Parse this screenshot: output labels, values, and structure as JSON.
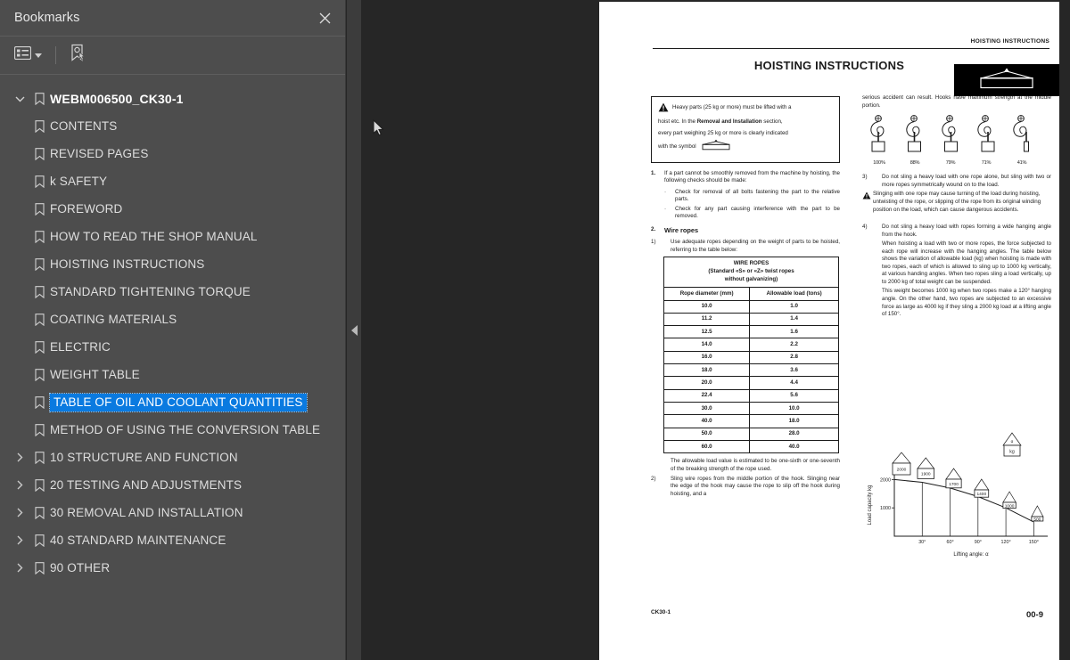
{
  "sidebar": {
    "title": "Bookmarks",
    "close_icon": "close-icon",
    "toolbar": {
      "options_icon": "list-options-icon",
      "caret_icon": "chevron-down-icon",
      "new_bookmark_icon": "new-bookmark-icon"
    },
    "root": {
      "label": "WEBM006500_CK30-1",
      "expanded": true
    },
    "items": [
      {
        "label": "CONTENTS",
        "expandable": false,
        "selected": false
      },
      {
        "label": "REVISED PAGES",
        "expandable": false,
        "selected": false
      },
      {
        "label": "k SAFETY",
        "expandable": false,
        "selected": false
      },
      {
        "label": "FOREWORD",
        "expandable": false,
        "selected": false
      },
      {
        "label": "HOW TO READ THE SHOP MANUAL",
        "expandable": false,
        "selected": false
      },
      {
        "label": "HOISTING INSTRUCTIONS",
        "expandable": false,
        "selected": false
      },
      {
        "label": "STANDARD TIGHTENING TORQUE",
        "expandable": false,
        "selected": false
      },
      {
        "label": "COATING MATERIALS",
        "expandable": false,
        "selected": false
      },
      {
        "label": "ELECTRIC",
        "expandable": false,
        "selected": false
      },
      {
        "label": "WEIGHT TABLE",
        "expandable": false,
        "selected": false
      },
      {
        "label": "TABLE OF OIL AND COOLANT QUANTITIES",
        "expandable": false,
        "selected": true
      },
      {
        "label": "METHOD OF USING THE CONVERSION TABLE",
        "expandable": false,
        "selected": false
      },
      {
        "label": "10 STRUCTURE AND FUNCTION",
        "expandable": true,
        "selected": false
      },
      {
        "label": "20 TESTING AND ADJUSTMENTS",
        "expandable": true,
        "selected": false
      },
      {
        "label": "30 REMOVAL AND INSTALLATION",
        "expandable": true,
        "selected": false
      },
      {
        "label": "40 STANDARD MAINTENANCE",
        "expandable": true,
        "selected": false
      },
      {
        "label": "90 OTHER",
        "expandable": true,
        "selected": false
      }
    ]
  },
  "collapse_handle": {
    "icon": "collapse-left-arrow-icon"
  },
  "page": {
    "running_head": "HOISTING INSTRUCTIONS",
    "title": "HOISTING INSTRUCTIONS",
    "symbol_box_icon": "hoisting-symbol-icon",
    "warning": {
      "icon": "warning-triangle-icon",
      "line1_a": "Heavy parts (25 kg or more) must be lifted with a",
      "line2_a": "hoist etc. In the ",
      "line2_b": "Removal and Installation",
      "line2_c": " section,",
      "line3": "every part weighing 25 kg or more is clearly indicated",
      "line4": "with the symbol"
    },
    "item1": {
      "marker": "1.",
      "text": "If a part cannot be smoothly removed from the machine by hoisting, the following checks should be made:",
      "bullets": [
        {
          "marker": "·",
          "text": "Check for removal of all bolts fastening the part to the relative parts."
        },
        {
          "marker": "·",
          "text": "Check for any part causing interference with the part to be removed."
        }
      ]
    },
    "item2": {
      "marker": "2.",
      "heading": "Wire ropes",
      "sub1_marker": "1)",
      "sub1_text": "Use adequate ropes depending on the weight of parts to be hoisted, referring to the table below:",
      "table_note": "The allowable load value is estimated to be one-sixth or one-seventh of the breaking strength of the rope used.",
      "sub2_marker": "2)",
      "sub2_text": "Sling wire ropes from the middle portion of the hook. Slinging near the edge of the hook may cause the rope to slip off the hook during hoisting, and a"
    },
    "wire_ropes_table": {
      "title_line1": "WIRE ROPES",
      "title_line2": "(Standard «S» or «Z» twist ropes",
      "title_line3": "without galvanizing)",
      "columns": [
        "Rope diameter (mm)",
        "Allowable load (tons)"
      ],
      "rows": [
        [
          "10.0",
          "1.0"
        ],
        [
          "11.2",
          "1.4"
        ],
        [
          "12.5",
          "1.6"
        ],
        [
          "14.0",
          "2.2"
        ],
        [
          "16.0",
          "2.8"
        ],
        [
          "18.0",
          "3.6"
        ],
        [
          "20.0",
          "4.4"
        ],
        [
          "22.4",
          "5.6"
        ],
        [
          "30.0",
          "10.0"
        ],
        [
          "40.0",
          "18.0"
        ],
        [
          "50.0",
          "28.0"
        ],
        [
          "60.0",
          "40.0"
        ]
      ]
    },
    "right_col": {
      "cont_text": "serious accident can result. Hooks have maximum strength at the middle portion.",
      "hook_labels": [
        "100%",
        "88%",
        "79%",
        "71%",
        "41%"
      ],
      "item3_marker": "3)",
      "item3_text": "Do not sling a heavy load with one rope alone, but sling with two or more ropes symmetrically wound on to the load.",
      "item3_warn": "Slinging with one rope may cause turning of the load during hoisting, untwisting of the rope, or slipping of the rope from its original winding position on the load, which can cause dangerous accidents.",
      "item4_marker": "4)",
      "item4_text": "Do not sling a heavy load with ropes forming a wide hanging angle from the hook.",
      "item4_text2": "When hoisting a load with two or more ropes, the force subjected to each rope will increase with the hanging angles. The table below shows the variation of allowable load (kg) when hoisting is made with two ropes, each of which is allowed to sling up to 1000 kg vertically, at various handing angles. When two ropes sling a load vertically, up to 2000 kg of total weight can be suspended.",
      "item4_text3": "This weight becomes 1000 kg when two ropes make a 120° hanging angle. On the other hand, two ropes are subjected to an excessive force as large as 4000 kg if they sling a 2000 kg load at a lifting angle of 150°."
    },
    "footer_left": "CK30-1",
    "footer_right": "00-9"
  },
  "chart_data": {
    "type": "line",
    "title": "",
    "xlabel": "Lifting angle: α",
    "ylabel": "Load capacity kg",
    "x": [
      0,
      30,
      60,
      90,
      120,
      150
    ],
    "values": [
      2000,
      1900,
      1700,
      1400,
      1000,
      500
    ],
    "xticklabels": [
      "30°",
      "60°",
      "90°",
      "120°",
      "150°"
    ],
    "yticklabels": [
      "1000",
      "2000"
    ],
    "yticks": [
      1000,
      2000
    ],
    "xlim": [
      0,
      165
    ],
    "ylim": [
      0,
      2200
    ],
    "grid": false,
    "legend": "none",
    "load_labels": [
      "2000",
      "1900",
      "1700",
      "1400",
      "1000",
      "500"
    ],
    "legend_box_label": "kg",
    "legend_box_angle": "α"
  },
  "colors": {
    "sidebar_bg": "#4d4d4d",
    "viewer_bg": "#262626",
    "handle_bg": "#3c3c3c",
    "selection": "#0a7ae0",
    "page_bg": "#ffffff"
  },
  "cursor": {
    "icon": "mouse-pointer-icon"
  }
}
